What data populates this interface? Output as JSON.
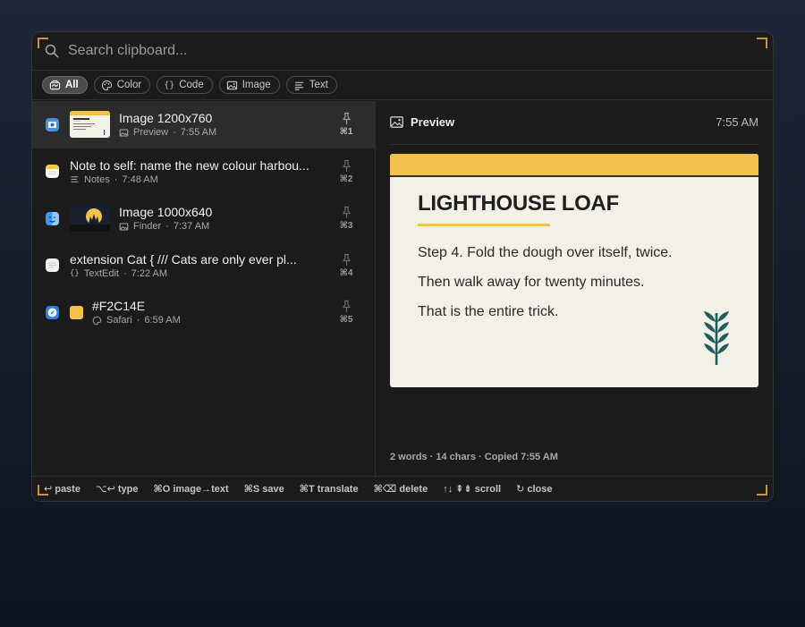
{
  "search": {
    "placeholder": "Search clipboard..."
  },
  "filters": [
    {
      "label": "All",
      "icon": "all-icon",
      "active": true
    },
    {
      "label": "Color",
      "icon": "palette-icon",
      "active": false
    },
    {
      "label": "Code",
      "icon": "braces-icon",
      "active": false
    },
    {
      "label": "Image",
      "icon": "image-icon",
      "active": false
    },
    {
      "label": "Text",
      "icon": "text-lines-icon",
      "active": false
    }
  ],
  "items": [
    {
      "title": "Image 1200x760",
      "source": "Preview",
      "time": "7:55 AM",
      "shortcut": "⌘1",
      "type": "image"
    },
    {
      "title": "Note to self: name the new colour harbou...",
      "source": "Notes",
      "time": "7:48 AM",
      "shortcut": "⌘2",
      "type": "text"
    },
    {
      "title": "Image 1000x640",
      "source": "Finder",
      "time": "7:37 AM",
      "shortcut": "⌘3",
      "type": "image"
    },
    {
      "title": "extension Cat {     /// Cats are only ever pl...",
      "source": "TextEdit",
      "time": "7:22 AM",
      "shortcut": "⌘4",
      "type": "code"
    },
    {
      "title": "#F2C14E",
      "source": "Safari",
      "time": "6:59 AM",
      "shortcut": "⌘5",
      "type": "color",
      "swatch": "#F2C14E"
    }
  ],
  "separator": "·",
  "preview": {
    "title": "Preview",
    "time": "7:55 AM",
    "card": {
      "heading": "LIGHTHOUSE LOAF",
      "lines": [
        "Step 4. Fold the dough over itself, twice.",
        "Then walk away for twenty minutes.",
        "That is the entire trick."
      ],
      "accent": "#F2C14E",
      "fern_color": "#1f5c5a"
    },
    "stats": "2 words · 14 chars  ·  Copied 7:55 AM"
  },
  "footer": [
    {
      "sym": "↩",
      "label": "paste"
    },
    {
      "sym": "⌥↩",
      "label": "type"
    },
    {
      "sym": "",
      "label": "⌘O image→text"
    },
    {
      "sym": "",
      "label": "⌘S save"
    },
    {
      "sym": "",
      "label": "⌘T translate"
    },
    {
      "sym": "",
      "label": "⌘⌫ delete"
    },
    {
      "sym": "",
      "label": "↑↓ ⇞⇟ scroll"
    },
    {
      "sym": "↻",
      "label": "close"
    }
  ],
  "colors": {
    "accent": "#c8963a",
    "background": "#1b1b1c"
  }
}
